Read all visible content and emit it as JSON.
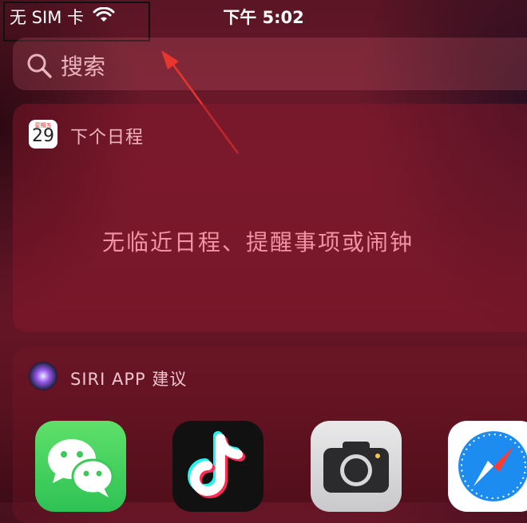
{
  "status_bar": {
    "carrier": "无 SIM 卡",
    "time": "下午 5:02"
  },
  "search": {
    "placeholder": "搜索"
  },
  "calendar_widget": {
    "icon_weekday": "星期五",
    "icon_day": "29",
    "title": "下个日程",
    "empty_message": "无临近日程、提醒事项或闹钟"
  },
  "siri_widget": {
    "title": "SIRI APP 建议",
    "apps": [
      {
        "name": "WeChat",
        "icon": "wechat-icon"
      },
      {
        "name": "TikTok",
        "icon": "tiktok-icon"
      },
      {
        "name": "Camera",
        "icon": "camera-icon"
      },
      {
        "name": "Safari",
        "icon": "safari-icon"
      }
    ]
  },
  "annotation": {
    "box_color": "#111111",
    "arrow_color": "#e8352e"
  }
}
